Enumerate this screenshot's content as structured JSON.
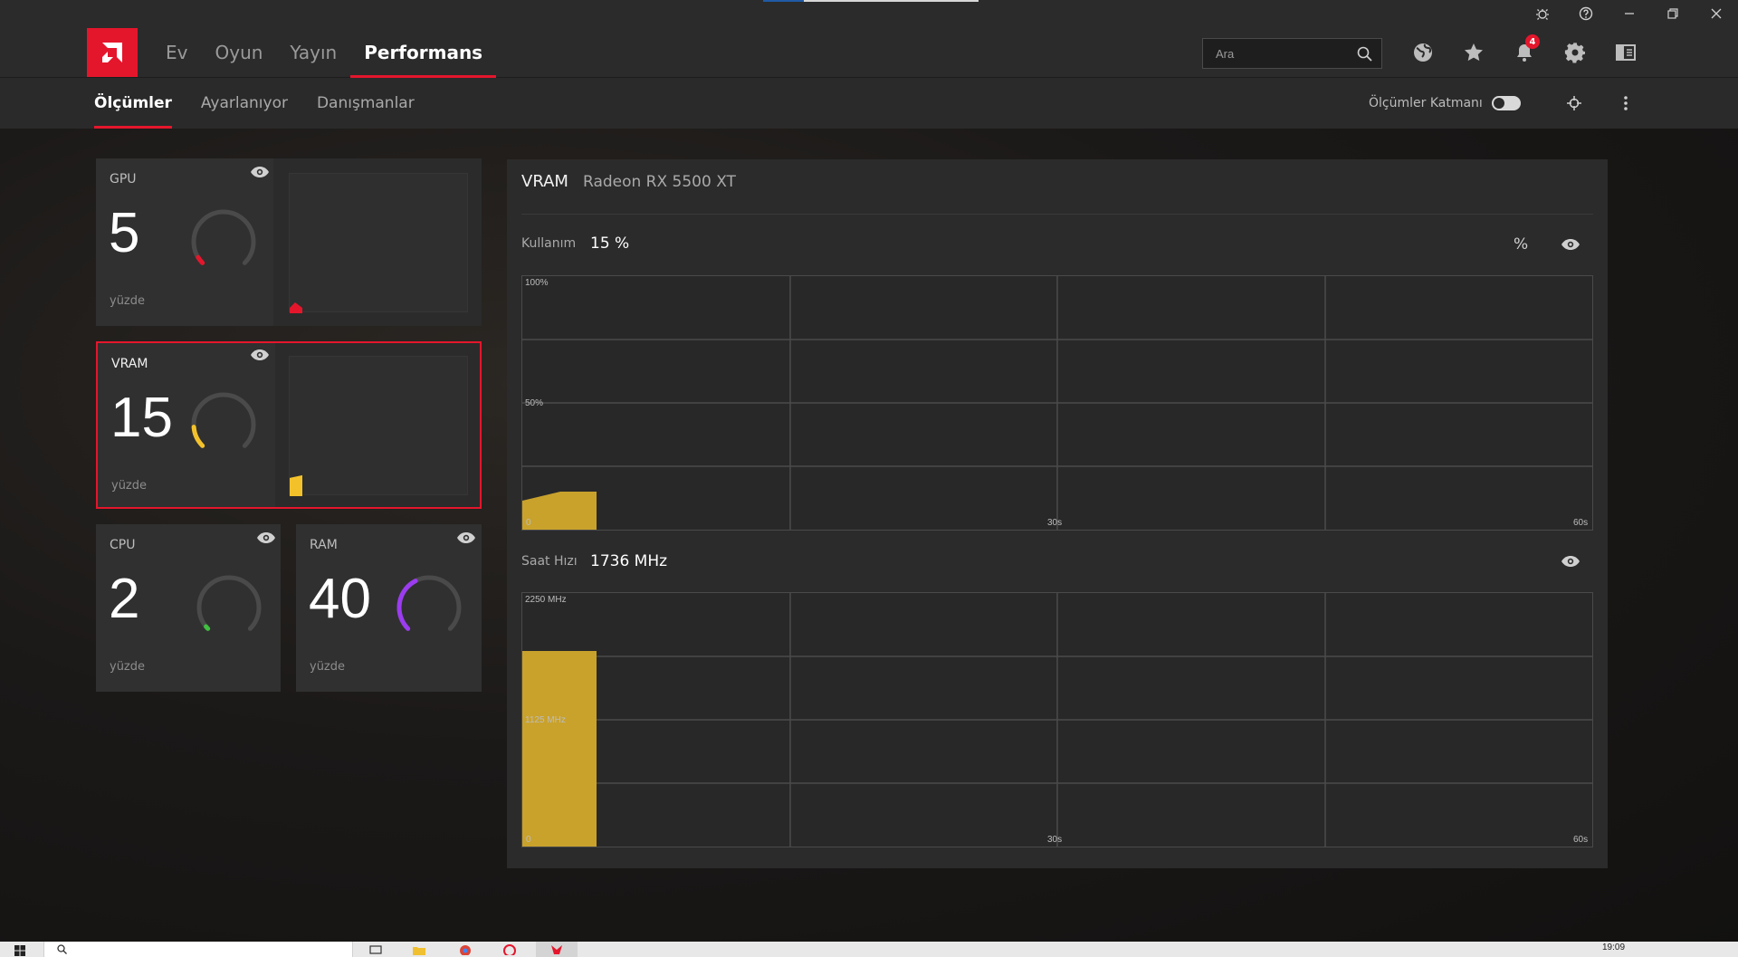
{
  "titlebar": {
    "buttons": [
      "bug-icon",
      "help-icon",
      "minimize-icon",
      "restore-icon",
      "close-icon"
    ]
  },
  "nav": {
    "tabs": [
      {
        "label": "Ev",
        "active": false
      },
      {
        "label": "Oyun",
        "active": false
      },
      {
        "label": "Yayın",
        "active": false
      },
      {
        "label": "Performans",
        "active": true
      }
    ],
    "search_placeholder": "Ara",
    "notification_count": "4"
  },
  "subnav": {
    "tabs": [
      {
        "label": "Ölçümler",
        "active": true
      },
      {
        "label": "Ayarlanıyor",
        "active": false
      },
      {
        "label": "Danışmanlar",
        "active": false
      }
    ],
    "overlay_label": "Ölçümler Katmanı",
    "overlay_on": false
  },
  "cards": {
    "gpu": {
      "label": "GPU",
      "value": "5",
      "unit": "yüzde",
      "level": 5,
      "color": "#e4162c"
    },
    "vram": {
      "label": "VRAM",
      "value": "15",
      "unit": "yüzde",
      "level": 15,
      "color": "#f3c22b"
    },
    "cpu": {
      "label": "CPU",
      "value": "2",
      "unit": "yüzde",
      "level": 2,
      "color": "#3fbf3f"
    },
    "ram": {
      "label": "RAM",
      "value": "40",
      "unit": "yüzde",
      "level": 40,
      "color": "#9b3cf0"
    }
  },
  "panel": {
    "title": "VRAM",
    "device": "Radeon RX 5500 XT",
    "usage": {
      "label": "Kullanım",
      "value": "15 %",
      "unit_toggle": "%",
      "y_top": "100%",
      "y_mid": "50%",
      "x_start": "0",
      "x_mid": "30s",
      "x_end": "60s",
      "fill_color": "#c9a22c"
    },
    "clock": {
      "label": "Saat Hızı",
      "value": "1736 MHz",
      "y_top": "2250 MHz",
      "y_mid": "1125 MHz",
      "x_start": "0",
      "x_mid": "30s",
      "x_end": "60s",
      "fill_color": "#c9a22c"
    }
  },
  "taskbar": {
    "time": "19:09"
  }
}
